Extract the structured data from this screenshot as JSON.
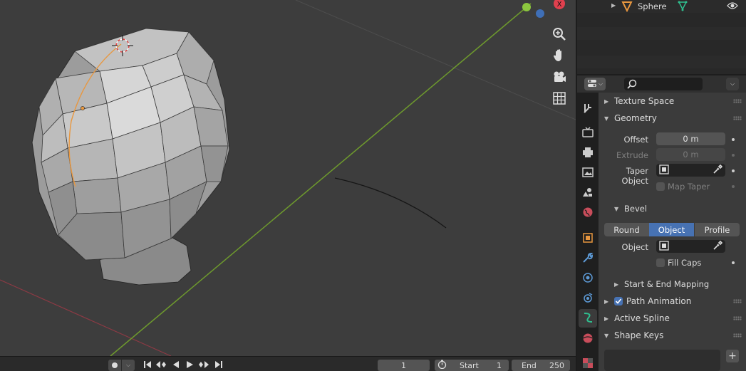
{
  "outliner": {
    "object_name": "Sphere"
  },
  "properties": {
    "search_placeholder": "",
    "panels": {
      "texture_space": "Texture Space",
      "geometry": "Geometry",
      "bevel": "Bevel",
      "start_end_mapping": "Start & End Mapping",
      "path_animation": "Path Animation",
      "active_spline": "Active Spline",
      "shape_keys": "Shape Keys"
    },
    "geometry": {
      "offset_label": "Offset",
      "offset_value": "0 m",
      "extrude_label": "Extrude",
      "extrude_value": "0 m",
      "taper_object_label": "Taper Object",
      "map_taper_label": "Map Taper"
    },
    "bevel": {
      "modes": [
        "Round",
        "Object",
        "Profile"
      ],
      "active_mode": "Object",
      "object_label": "Object",
      "fill_caps_label": "Fill Caps"
    },
    "path_animation_checked": true
  },
  "timeline": {
    "current_frame": "1",
    "start_label": "Start",
    "start_value": "1",
    "end_label": "End",
    "end_value": "250"
  },
  "gizmo": {
    "x_label": "X"
  },
  "colors": {
    "accent": "#4772b3",
    "x_axis": "#cc3d4f",
    "y_axis": "#6e9a2d",
    "curve": "#e8973f"
  }
}
